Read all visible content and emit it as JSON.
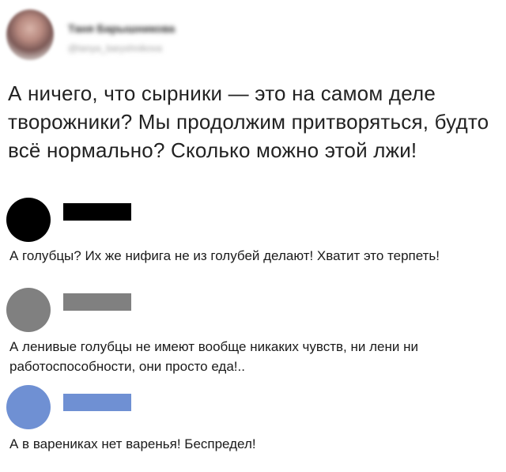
{
  "post": {
    "author_name": "Таня Барышникова",
    "author_handle": "@tanya_baryshnikova",
    "text": "А ничего, что сырники — это на самом деле творожники? Мы продолжим притворяться, будто всё нормально? Сколько можно этой лжи!"
  },
  "comments": [
    {
      "avatar_color": "#000000",
      "name_bar_color": "#000000",
      "text": "А голубцы? Их же нифига не из голубей делают! Хватит это терпеть!"
    },
    {
      "avatar_color": "#808080",
      "name_bar_color": "#808080",
      "text": "А ленивые голубцы не имеют вообще никаких чувств, ни лени ни работоспособности, они просто еда!.."
    },
    {
      "avatar_color": "#6f90d3",
      "name_bar_color": "#6f90d3",
      "text": "А в варениках нет варенья! Беспредел!"
    }
  ]
}
